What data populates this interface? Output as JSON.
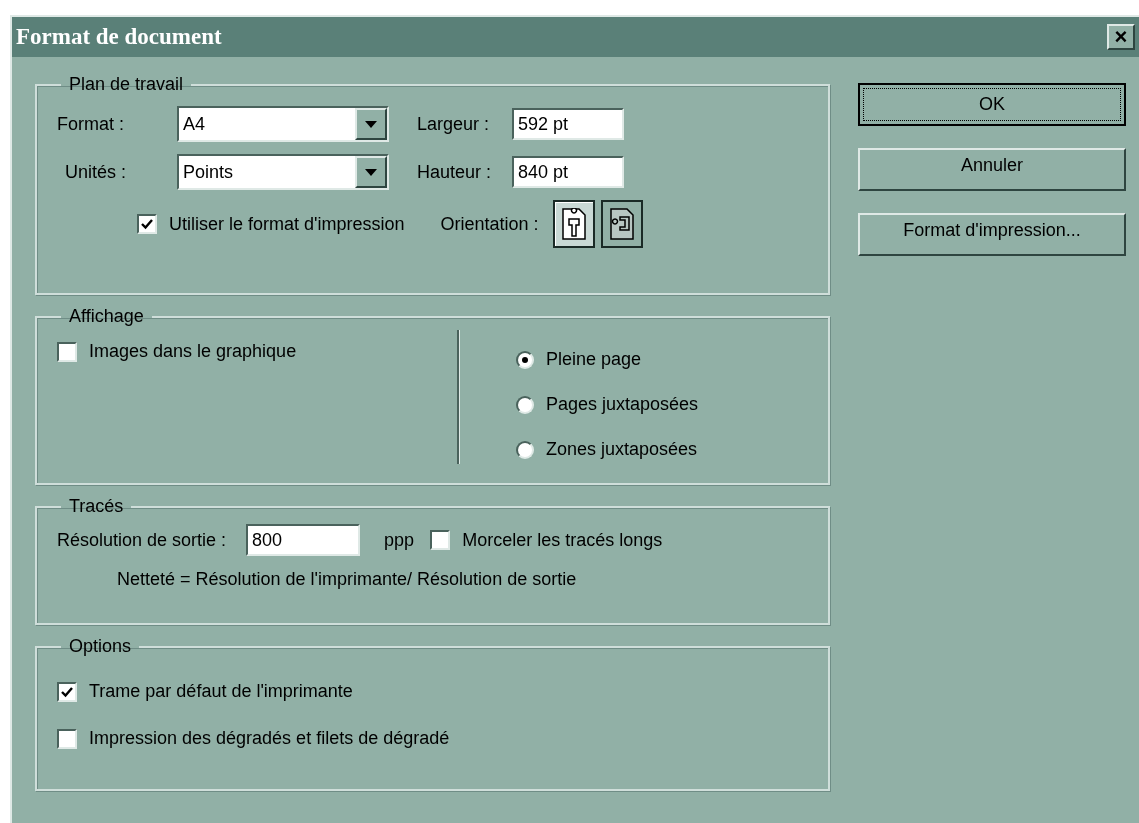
{
  "window": {
    "title": "Format de document",
    "close": "×"
  },
  "plan_de_travail": {
    "title": "Plan de travail",
    "format": {
      "label": "Format :",
      "value": "A4"
    },
    "unites": {
      "label": "Unités :",
      "value": "Points"
    },
    "largeur": {
      "label": "Largeur :",
      "value": "592 pt"
    },
    "hauteur": {
      "label": "Hauteur :",
      "value": "840 pt"
    },
    "use_print_format": {
      "label": "Utiliser le format d'impression",
      "checked": true
    },
    "orientation": {
      "label": "Orientation :",
      "options": [
        {
          "kind": "portrait",
          "selected": true
        },
        {
          "kind": "landscape",
          "selected": false
        }
      ]
    }
  },
  "affichage": {
    "title": "Affichage",
    "images": {
      "label": "Images dans le graphique",
      "checked": false
    },
    "modes": [
      {
        "label": "Pleine page",
        "selected": true
      },
      {
        "label": "Pages juxtaposées",
        "selected": false
      },
      {
        "label": "Zones juxtaposées",
        "selected": false
      }
    ]
  },
  "traces": {
    "title": "Tracés",
    "resolution": {
      "label": "Résolution de sortie :",
      "value": "800",
      "unit": "ppp"
    },
    "split_long": {
      "label": "Morceler les tracés longs",
      "checked": false
    },
    "note": "Netteté = Résolution de l'imprimante/ Résolution de sortie"
  },
  "options": {
    "title": "Options",
    "items": [
      {
        "label": "Trame par défaut de l'imprimante",
        "checked": true
      },
      {
        "label": "Impression des dégradés et filets de dégradé",
        "checked": false
      }
    ]
  },
  "buttons": [
    {
      "label": "OK",
      "default": true
    },
    {
      "label": "Annuler",
      "default": false
    },
    {
      "label": "Format d'impression...",
      "default": false
    }
  ]
}
